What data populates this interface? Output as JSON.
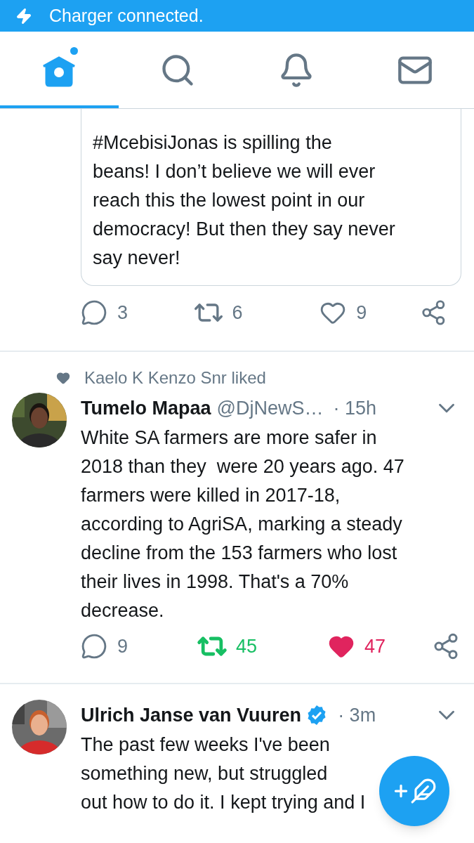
{
  "status_bar": {
    "message": "Charger connected."
  },
  "tabs": [
    {
      "kind": "home",
      "selected": true,
      "dot": true
    },
    {
      "kind": "search",
      "selected": false,
      "dot": false
    },
    {
      "kind": "notifications",
      "selected": false,
      "dot": false
    },
    {
      "kind": "messages",
      "selected": false,
      "dot": false
    }
  ],
  "tweets": [
    {
      "kind": "quote_fragment",
      "quote_text": "#McebisiJonas is spilling the\nbeans! I don’t believe we will ever\nreach this the lowest point in our\ndemocracy! But then they say never\nsay never!",
      "actions": {
        "reply": "3",
        "retweet": "6",
        "retweeted": false,
        "like": "9",
        "liked": false
      }
    },
    {
      "kind": "tweet",
      "liked_by": "Kaelo K Kenzo Snr liked",
      "name": "Tumelo Mapaa",
      "verified": false,
      "handle": "@DjNewS…",
      "time": "· 15h",
      "text": "White SA farmers are more safer in\n2018 than they  were 20 years ago. 47\nfarmers were killed in 2017-18,\naccording to AgriSA, marking a steady\ndecline from the 153 farmers who lost\ntheir lives in 1998. That's a 70%\ndecrease.",
      "actions": {
        "reply": "9",
        "retweet": "45",
        "retweeted": true,
        "like": "47",
        "liked": true
      }
    },
    {
      "kind": "tweet",
      "name": "Ulrich Janse van Vuuren",
      "verified": true,
      "time": "· 3m",
      "text": "The past few weeks I've been\nsomething new, but struggled\nout how to do it. I kept trying and I"
    }
  ]
}
